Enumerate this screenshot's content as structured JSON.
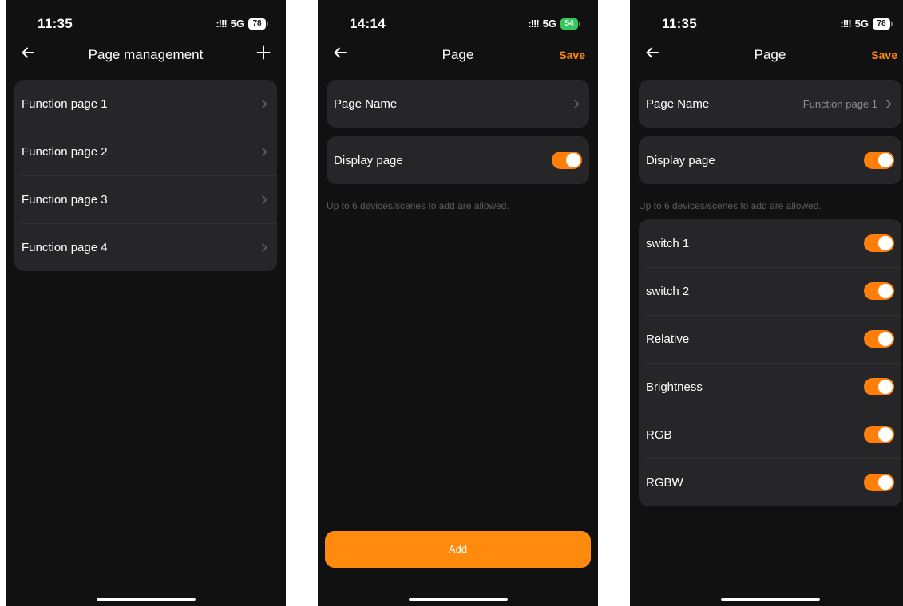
{
  "screen1": {
    "status": {
      "time": "11:35",
      "signal": ":!!!",
      "network": "5G",
      "battery": "78"
    },
    "header": {
      "title": "Page management"
    },
    "pages": [
      {
        "label": "Function page 1"
      },
      {
        "label": "Function page 2"
      },
      {
        "label": "Function page 3"
      },
      {
        "label": "Function page 4"
      }
    ]
  },
  "screen2": {
    "status": {
      "time": "14:14",
      "signal": ":!!!",
      "network": "5G",
      "battery": "54"
    },
    "header": {
      "title": "Page",
      "save_label": "Save"
    },
    "page_name": {
      "label": "Page Name"
    },
    "display_page": {
      "label": "Display page",
      "enabled": true
    },
    "hint": "Up to 6 devices/scenes to add are allowed.",
    "add_label": "Add"
  },
  "screen3": {
    "status": {
      "time": "11:35",
      "signal": ":!!!",
      "network": "5G",
      "battery": "78"
    },
    "header": {
      "title": "Page",
      "save_label": "Save"
    },
    "page_name": {
      "label": "Page Name",
      "value": "Function page 1"
    },
    "display_page": {
      "label": "Display page",
      "enabled": true
    },
    "hint": "Up to 6 devices/scenes to add are allowed.",
    "devices": [
      {
        "label": "switch 1",
        "enabled": true
      },
      {
        "label": "switch 2",
        "enabled": true
      },
      {
        "label": "Relative",
        "enabled": true
      },
      {
        "label": "Brightness",
        "enabled": true
      },
      {
        "label": "RGB",
        "enabled": true
      },
      {
        "label": "RGBW",
        "enabled": true
      }
    ]
  },
  "colors": {
    "accent": "#ff8a0d",
    "background": "#111111",
    "card": "#262628",
    "charging": "#34c759"
  },
  "icons": [
    "back-arrow-icon",
    "plus-icon",
    "chevron-right-icon",
    "signal-icon",
    "battery-icon"
  ]
}
